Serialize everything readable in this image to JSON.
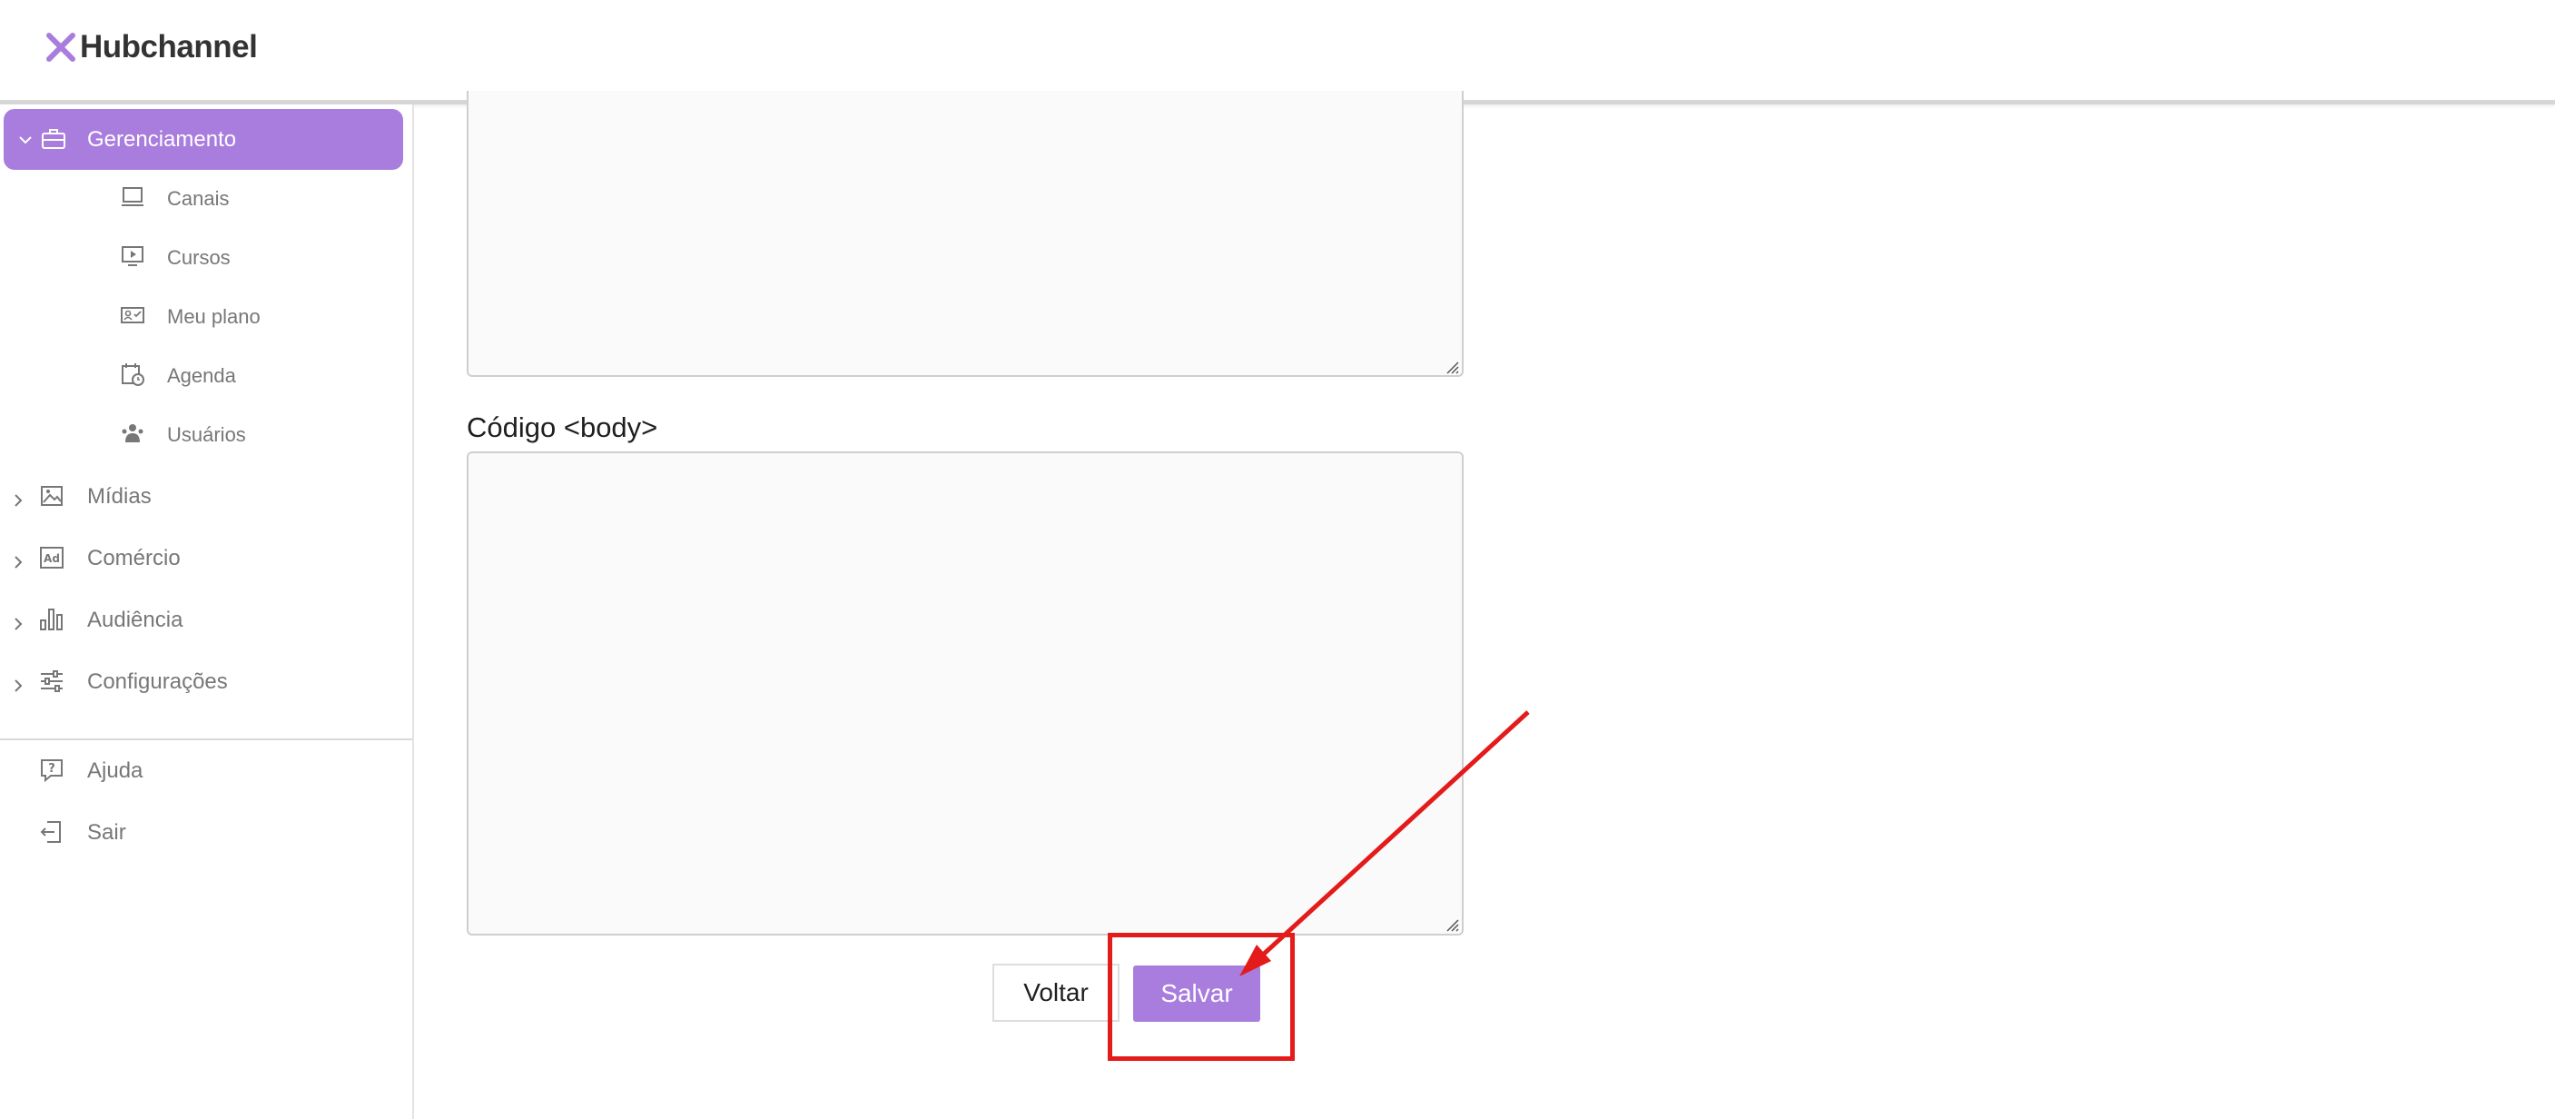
{
  "header": {
    "brand": "Hubchannel",
    "brand_color": "#a97ddd"
  },
  "sidebar": {
    "active_section": {
      "label": "Gerenciamento",
      "icon": "briefcase-icon",
      "expanded": true
    },
    "sub_items": [
      {
        "label": "Canais",
        "icon": "monitor-icon"
      },
      {
        "label": "Cursos",
        "icon": "video-play-icon"
      },
      {
        "label": "Meu plano",
        "icon": "id-card-icon"
      },
      {
        "label": "Agenda",
        "icon": "calendar-clock-icon"
      },
      {
        "label": "Usuários",
        "icon": "users-icon"
      }
    ],
    "sections": [
      {
        "label": "Mídias",
        "icon": "image-icon"
      },
      {
        "label": "Comércio",
        "icon": "ad-icon"
      },
      {
        "label": "Audiência",
        "icon": "bar-chart-icon"
      },
      {
        "label": "Configurações",
        "icon": "sliders-icon"
      }
    ],
    "footer": [
      {
        "label": "Ajuda",
        "icon": "help-icon"
      },
      {
        "label": "Sair",
        "icon": "logout-icon"
      }
    ]
  },
  "main": {
    "body_code_label": "Código <body>",
    "head_code_value": "",
    "body_code_value": "",
    "back_button": "Voltar",
    "save_button": "Salvar"
  },
  "colors": {
    "accent": "#a97ddd",
    "annotation": "#e31b1b",
    "muted_text": "#777777"
  }
}
